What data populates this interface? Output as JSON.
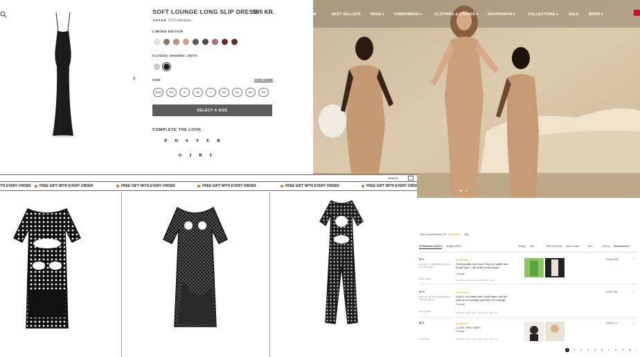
{
  "product": {
    "title": "SOFT LOUNGE LONG SLIP DRESS",
    "price": "595 KR.",
    "rating_stars": "★★★★★",
    "review_count": "2,571 Reviews",
    "limited_edition_label": "LIMITED EDITION",
    "limited_swatches": [
      "#e9e6e1",
      "#8d7a5f",
      "#b89675",
      "#cfa48a",
      "#5c5a50",
      "#4a4f47",
      "#b56b78",
      "#6b2a2e",
      "#5a3524"
    ],
    "classic_label": "CLASSIC SHADES: ONYX",
    "classic_swatches": [
      "#c9c9c9",
      "#1c1c1c"
    ],
    "size_label": "SIZE",
    "size_guide": "SIZE GUIDE",
    "sizes": [
      "XXS",
      "XS",
      "S",
      "M",
      "L",
      "XL",
      "2X",
      "3X",
      "4X"
    ],
    "select_button": "SELECT A SIZE",
    "complete_look": "COMPLETE THE LOOK",
    "logo_line1": "POSTER",
    "logo_line2": "GIRL"
  },
  "hero": {
    "nav": [
      "NEW",
      "BEST SELLERS",
      "BRAS ▾",
      "UNDERWEAR ▾",
      "CLOTHING & LOUNGE ▾",
      "SHAPEWEAR ▾",
      "COLLECTIONS ▾",
      "SALE",
      "MORE ▾"
    ]
  },
  "catalog": {
    "search_label": "Search",
    "promo_text": "FREE GIFT WITH EVERY ORDER",
    "promo_accent": "#d5722c"
  },
  "reviews": {
    "verified_label": "View Local Reviews 4.8",
    "header_stars": "★★★★★",
    "tab_all": "All Reviews (1022+)",
    "tab_image": "Image (999+)",
    "filter_rating": "Rating",
    "filter_rating_value": "All ▾",
    "filter_product": "Filter by product",
    "filter_product_value": "loose ▾ rated",
    "filter_all": "All ▾",
    "sort_label": "Sort by",
    "sort_value": "Recommend ▾",
    "items": [
      {
        "user": "R**l",
        "meta": "Bust Size: 32 34DD 85 E Hips: 40 cm / 90 in Size: L",
        "date": "18 Nov 2022",
        "stars": "★★★★★",
        "text": "Great quality love how it fits my height and length size, I did order a size larger.",
        "translate": "Translate",
        "footer": "Overall Fit: True to Size · Color: Black · Size: L",
        "helpful": "Helpful (233)",
        "more": "···"
      },
      {
        "user": "A**s",
        "meta": "Bust size: 32 34 DD Weight: 88 kg / 150 lbs Size: M",
        "date": "24 Aug 2022",
        "stars": "★★★★★",
        "text": "Love it. It's made with a soft fabric and the color is so beautiful (just like I'm looking)",
        "translate": "Translate",
        "footer": "Overall Fit: True to Size · Color: Onyx · Size: XS",
        "helpful": "Helpful (56)",
        "more": "···"
      },
      {
        "user": "M**l",
        "meta": "",
        "date": "4 Jun 2022",
        "stars": "★★★★★",
        "text": "I LOVE THIS TOP!!!",
        "translate": "Translate",
        "footer": "Overall Fit: True to Size · Color: Onyx · Size: XS",
        "helpful": "Helpful (77)",
        "more": "···"
      }
    ],
    "pages": [
      "1",
      "2",
      "3",
      "4",
      "5",
      "6",
      "7",
      "8",
      "9",
      "10"
    ],
    "next": "›"
  }
}
